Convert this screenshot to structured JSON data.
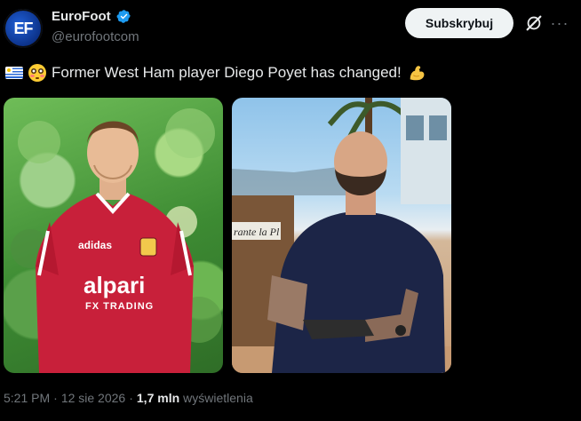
{
  "author": {
    "name": "EuroFoot",
    "handle": "@eurofootcom",
    "avatar_text": "EF",
    "verified": true,
    "verified_icon": "verified-badge-icon"
  },
  "actions": {
    "subscribe_label": "Subskrybuj",
    "grok_icon": "grok-icon",
    "more_icon": "more-icon"
  },
  "post": {
    "text": "Former West Ham player Diego Poyet has changed!",
    "leading_icons": [
      "uruguay-flag-icon",
      "flushed-face-icon"
    ],
    "trailing_icon": "flexed-biceps-icon"
  },
  "media": {
    "left_photo": {
      "shirt_sponsor_line1": "alpari",
      "shirt_sponsor_line2": "FX TRADING"
    },
    "right_photo": {
      "sign_text": "rante la Pl"
    }
  },
  "meta": {
    "time": "5:21 PM",
    "date": "12 sie 2026",
    "separator": "·",
    "views_count": "1,7 mln",
    "views_label": "wyświetlenia"
  },
  "colors": {
    "background": "#000000",
    "primary_text": "#e7e9ea",
    "secondary_text": "#71767b",
    "verified": "#1d9bf0",
    "button_bg": "#eff3f4",
    "shirt": "#c8203a"
  }
}
